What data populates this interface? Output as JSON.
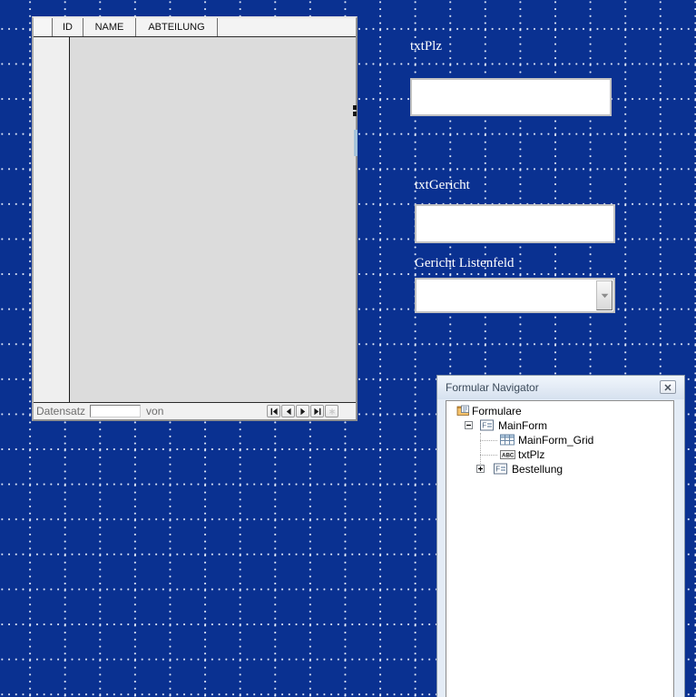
{
  "colors": {
    "canvas_blue": "#0a3191",
    "grid_dot": "#f0f5ff",
    "table_body_gray": "#dcdcdc",
    "table_header_gray": "#f3f3f3",
    "navigator_frame": "#e4ecf6"
  },
  "grid_table": {
    "columns": [
      "ID",
      "NAME",
      "ABTEILUNG"
    ],
    "record_bar": {
      "label": "Datensatz",
      "record_value": "",
      "of_label": "von",
      "buttons": [
        "first-record",
        "previous-record",
        "next-record",
        "last-record",
        "new-record"
      ]
    }
  },
  "form_controls": {
    "txtplz_label": "txtPlz",
    "txtplz_value": "",
    "txtgericht_label": "txtGericht",
    "txtgericht_value": "",
    "listenfeld_label": "Gericht Listenfeld",
    "listenfeld_value": ""
  },
  "navigator": {
    "title": "Formular Navigator",
    "tree": [
      {
        "label": "Formulare",
        "icon": "forms-folder-icon",
        "level": 0
      },
      {
        "label": "MainForm",
        "icon": "form-icon",
        "level": 1,
        "expander": "minus"
      },
      {
        "label": "MainForm_Grid",
        "icon": "table-grid-icon",
        "level": 2
      },
      {
        "label": "txtPlz",
        "icon": "text-field-icon",
        "level": 2
      },
      {
        "label": "Bestellung",
        "icon": "form-icon",
        "level": 2,
        "expander": "plus"
      }
    ]
  }
}
